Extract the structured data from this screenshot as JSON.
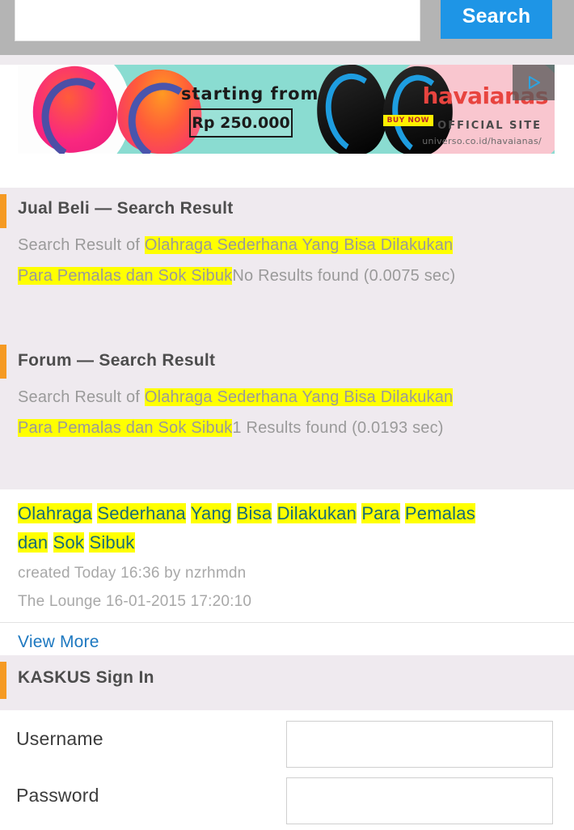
{
  "search": {
    "query_value": "",
    "placeholder": "",
    "button_label": "Search"
  },
  "ad": {
    "starting_from": "starting from",
    "price": "Rp 250.000",
    "brand": "havaianas",
    "buy_now": "BUY NOW",
    "official_site": "OFFICIAL SITE",
    "url": "universo.co.id/havaianas/",
    "play_icon": "play-icon"
  },
  "sections": [
    {
      "title": "Jual Beli — Search Result",
      "prefix": "Search Result of ",
      "query_line1": "Olahraga Sederhana Yang Bisa Dilakukan",
      "query_line2": "Para Pemalas dan Sok Sibuk",
      "suffix": "No Results found (0.0075 sec)"
    },
    {
      "title": "Forum — Search Result",
      "prefix": "Search Result of ",
      "query_line1": "Olahraga Sederhana Yang Bisa Dilakukan",
      "query_line2": "Para Pemalas dan Sok Sibuk",
      "suffix": "1 Results found (0.0193 sec)"
    }
  ],
  "result": {
    "title_words": [
      "Olahraga",
      "Sederhana",
      "Yang",
      "Bisa",
      "Dilakukan",
      "Para",
      "Pemalas",
      "dan",
      "Sok",
      "Sibuk"
    ],
    "title_line1": "Olahraga Sederhana Yang Bisa Dilakukan Para Pemalas",
    "title_line2": "dan Sok Sibuk",
    "meta_created": "created Today  16:36  by nzrhmdn",
    "meta_forum": "The Lounge 16-01-2015  17:20:10",
    "view_more_label": "View More"
  },
  "signin": {
    "title": "KASKUS Sign In",
    "username_label": "Username",
    "username_value": "",
    "password_label": "Password",
    "password_value": ""
  },
  "colors": {
    "accent_orange": "#f59a23",
    "link_blue": "#1d78c0",
    "button_blue": "#1e95e6",
    "highlight_yellow": "#ffff00",
    "panel_bg": "#efeaef",
    "title_teal": "#166b78"
  }
}
